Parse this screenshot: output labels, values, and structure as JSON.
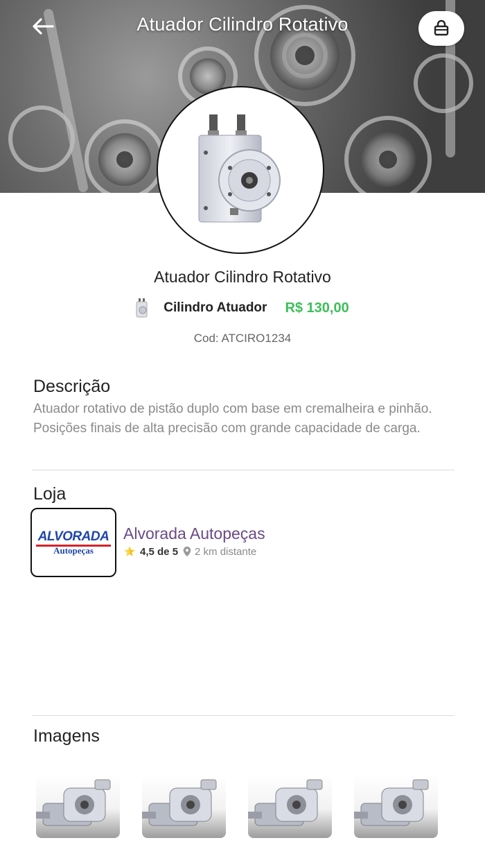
{
  "header": {
    "title": "Atuador Cilindro Rotativo"
  },
  "product": {
    "name": "Atuador Cilindro Rotativo",
    "category": "Cilindro Atuador",
    "price": "R$ 130,00",
    "code": "Cod: ATCIRO1234"
  },
  "description": {
    "title": "Descrição",
    "text": "Atuador rotativo de pistão duplo com base em cremalheira e pinhão. Posições finais de alta precisão com grande capacidade de carga."
  },
  "store": {
    "section_title": "Loja",
    "logo_main": "ALVORADA",
    "logo_sub": "Autopeças",
    "name": "Alvorada Autopeças",
    "rating": "4,5 de 5",
    "distance": "2 km distante"
  },
  "images": {
    "title": "Imagens",
    "count": 4
  },
  "colors": {
    "price": "#3cbf5a",
    "store_name": "#6a4a86",
    "logo_blue": "#1f46a8",
    "logo_red": "#d2232a"
  },
  "icons": [
    "back-arrow-icon",
    "shopping-bag-icon",
    "star-icon",
    "location-pin-icon"
  ]
}
